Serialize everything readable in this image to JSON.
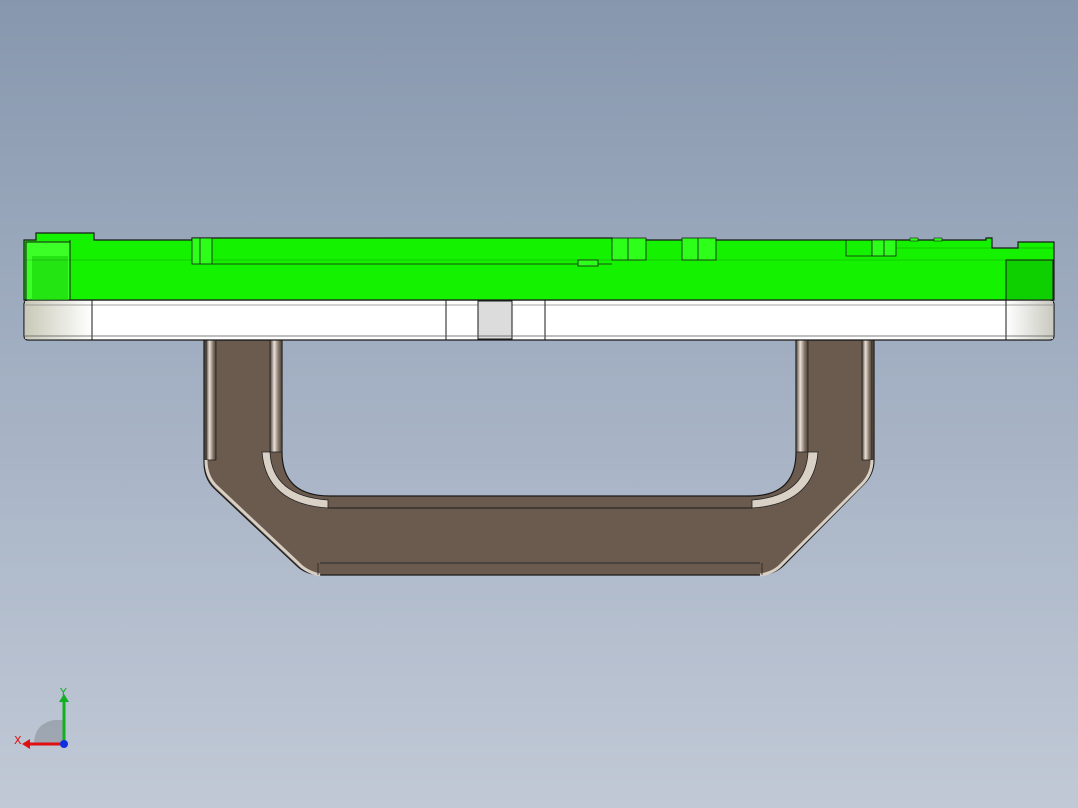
{
  "viewport": {
    "background_top": "#8797ad",
    "background_bottom": "#c1c9d6"
  },
  "model": {
    "top_plate_color": "#15f200",
    "base_plate_color": "#ffffff",
    "handle_color": "#6b5a4e"
  },
  "triad": {
    "x_label": "X",
    "y_label": "Y",
    "x_color": "#e01010",
    "y_color": "#10b020",
    "z_color": "#1030e0"
  }
}
